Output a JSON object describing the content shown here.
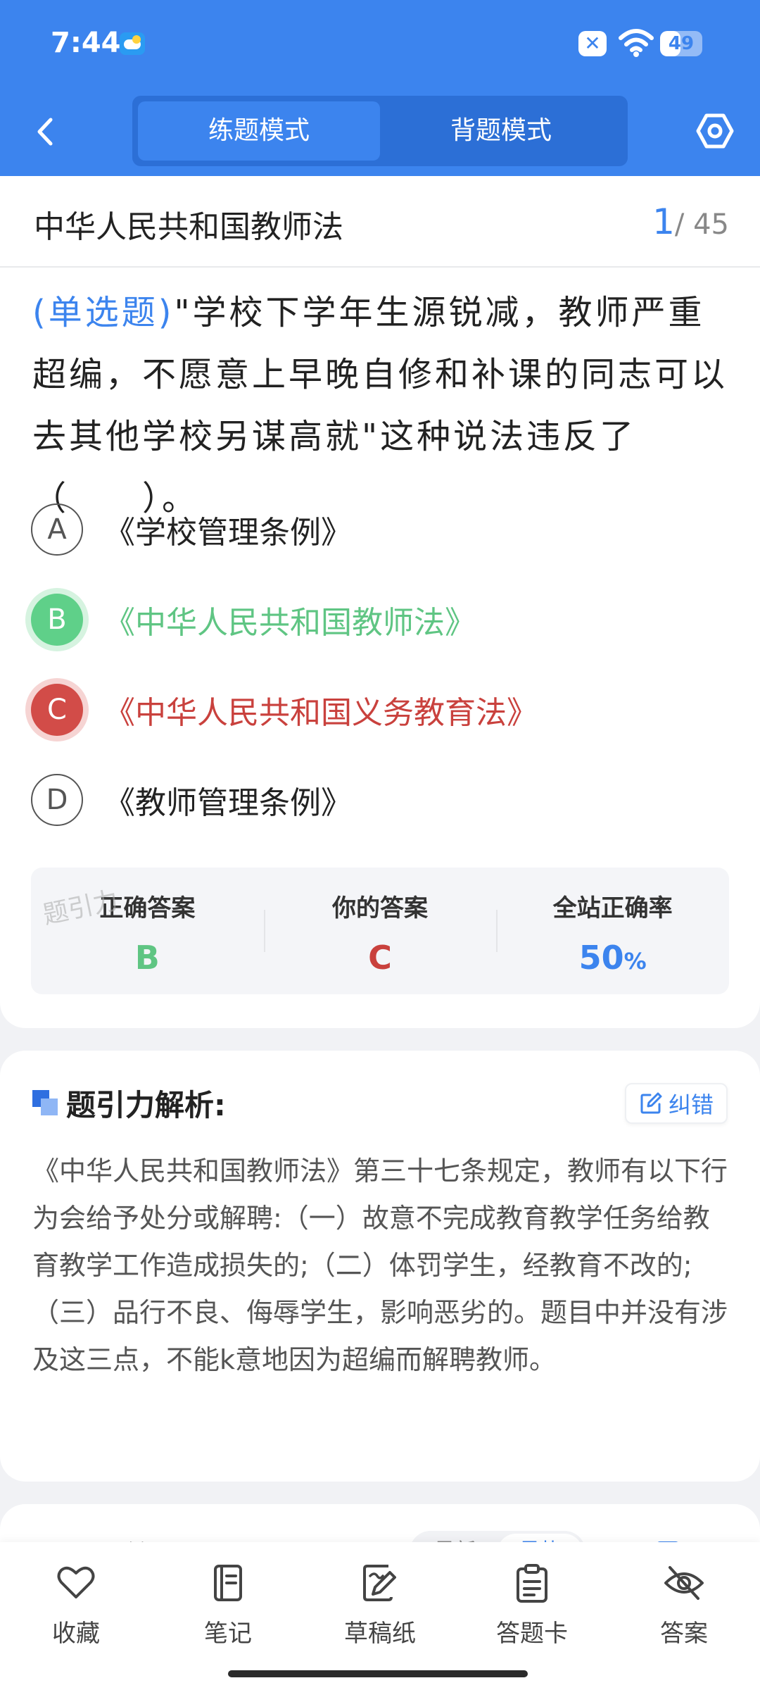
{
  "status_bar": {
    "time": "7:44",
    "battery_level": "49",
    "battery_fraction": 0.49
  },
  "header": {
    "tabs": [
      {
        "label": "练题模式",
        "active": true
      },
      {
        "label": "背题模式",
        "active": false
      }
    ]
  },
  "question": {
    "section_title": "中华人民共和国教师法",
    "current": "1",
    "total": "/ 45",
    "type_label": "(单选题)",
    "text": "\"学校下学年生源锐减，教师严重超编，不愿意上早晚自修和补课的同志可以去其他学校另谋高就\"这种说法违反了（　　）。",
    "options": [
      {
        "letter": "A",
        "text": "《学校管理条例》",
        "state": "normal"
      },
      {
        "letter": "B",
        "text": "《中华人民共和国教师法》",
        "state": "correct"
      },
      {
        "letter": "C",
        "text": "《中华人民共和国义务教育法》",
        "state": "wrong"
      },
      {
        "letter": "D",
        "text": "《教师管理条例》",
        "state": "normal"
      }
    ]
  },
  "answer_summary": {
    "correct_label": "正确答案",
    "correct_value": "B",
    "yours_label": "你的答案",
    "yours_value": "C",
    "rate_label": "全站正确率",
    "rate_value": "50",
    "rate_unit": "%",
    "watermark": "题引力"
  },
  "analysis": {
    "title": "题引力解析:",
    "correct_button": "纠错",
    "text": "《中华人民共和国教师法》第三十七条规定，教师有以下行为会给予处分或解聘:（一）故意不完成教育教学任务给教育教学工作造成损失的;（二）体罚学生，经教育不改的;（三）品行不良、侮辱学生，影响恶劣的。题目中并没有涉及这三点，不能k意地因为超编而解聘教师。"
  },
  "notes": {
    "title": "公开笔记:",
    "sort_tabs": [
      "最新",
      "最热"
    ],
    "add_label": "添加"
  },
  "bottom_nav": {
    "favorite": "收藏",
    "notes": "笔记",
    "draft": "草稿纸",
    "answer_card": "答题卡",
    "answer": "答案"
  },
  "colors": {
    "primary": "#3c84ee",
    "correct": "#5fc583",
    "wrong": "#c9413d"
  }
}
